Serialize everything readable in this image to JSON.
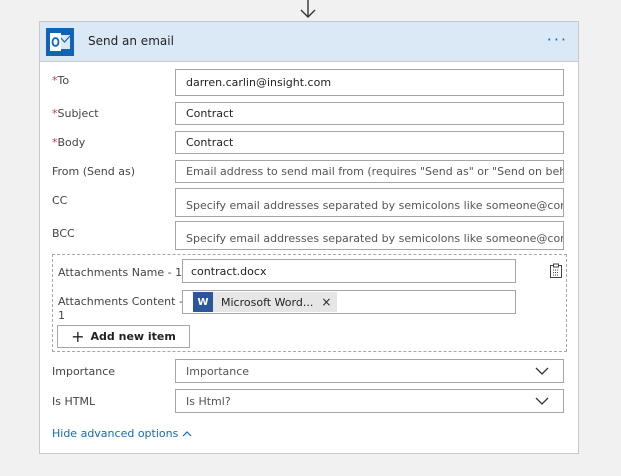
{
  "card": {
    "title": "Send an email",
    "more_label": "···",
    "brand_color": "#0f64b5"
  },
  "fields": {
    "to": {
      "label": "To",
      "value": "darren.carlin@insight.com"
    },
    "subject": {
      "label": "Subject",
      "value": "Contract"
    },
    "body": {
      "label": "Body",
      "value": "Contract"
    },
    "from": {
      "label": "From (Send as)",
      "placeholder": "Email address to send mail from (requires \"Send as\" or \"Send on behalf of\""
    },
    "cc": {
      "label": "CC",
      "placeholder": "Specify email addresses separated by semicolons like someone@contoso.com"
    },
    "bcc": {
      "label": "BCC",
      "placeholder": "Specify email addresses separated by semicolons like someone@contoso.com"
    }
  },
  "required_marker": "*",
  "attachments": {
    "name_label": "Attachments Name - 1",
    "name_value": "contract.docx",
    "content_label_line1": "Attachments Content -",
    "content_label_line2": "1",
    "content_chip": "Microsoft Word...",
    "chip_icon_letter": "W",
    "chip_close": "×",
    "add_item_label": "Add new item"
  },
  "importance": {
    "label": "Importance",
    "value": "Importance"
  },
  "is_html": {
    "label": "Is HTML",
    "value": "Is Html?"
  },
  "advanced_toggle": "Hide advanced options"
}
